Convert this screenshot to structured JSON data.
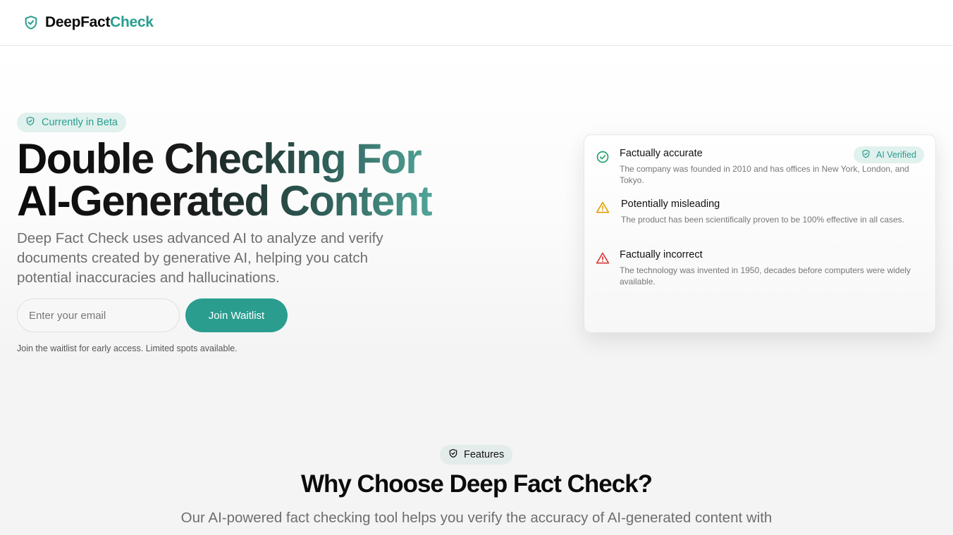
{
  "brand": {
    "part1": "DeepFact",
    "part2": "Check",
    "accent_color": "#2a9d8f",
    "icon": "shield-check-icon"
  },
  "hero": {
    "badge": "Currently in Beta",
    "headline_line1": "Double Checking For",
    "headline_line2": "AI-Generated Content",
    "subtext": "Deep Fact Check uses advanced AI to analyze and verify documents created by generative AI, helping you catch potential inaccuracies and hallucinations.",
    "email_placeholder": "Enter your email",
    "join_button": "Join Waitlist",
    "note": "Join the waitlist for early access. Limited spots available."
  },
  "demo_card": {
    "badge": "AI Verified",
    "items": [
      {
        "status": "accurate",
        "icon": "check-circle-icon",
        "color": "#22a06b",
        "title": "Factually accurate",
        "description": "The company was founded in 2010 and has offices in New York, London, and Tokyo."
      },
      {
        "status": "misleading",
        "icon": "warning-triangle-icon",
        "color": "#e0a100",
        "title": "Potentially misleading",
        "description": "The product has been scientifically proven to be 100% effective in all cases."
      },
      {
        "status": "incorrect",
        "icon": "alert-triangle-icon",
        "color": "#dc3b3b",
        "title": "Factually incorrect",
        "description": "The technology was invented in 1950, decades before computers were widely available."
      }
    ]
  },
  "features": {
    "badge": "Features",
    "title": "Why Choose Deep Fact Check?",
    "subtitle": "Our AI-powered fact checking tool helps you verify the accuracy of AI-generated content with"
  }
}
